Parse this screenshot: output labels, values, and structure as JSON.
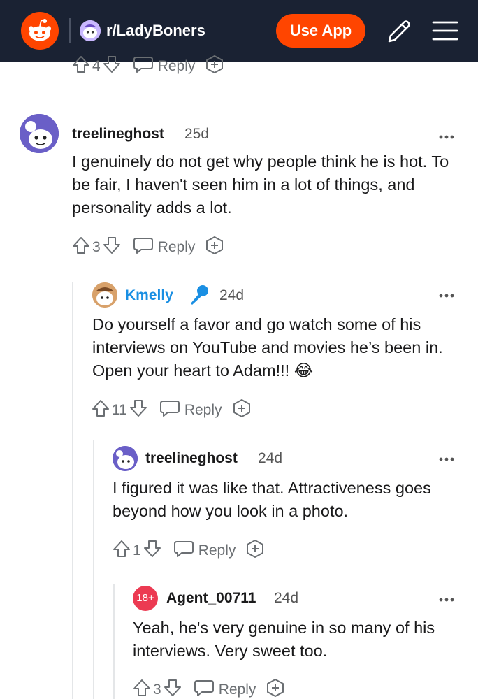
{
  "header": {
    "subreddit": "r/LadyBoners",
    "use_app_label": "Use App",
    "logo_icon": "reddit-logo-icon",
    "edit_icon": "pencil-icon",
    "menu_icon": "hamburger-menu-icon",
    "colors": {
      "bar": "#1a2233",
      "accent": "#ff4500"
    }
  },
  "previous_comment_actions": {
    "votes": "4",
    "reply_label": "Reply"
  },
  "comments": [
    {
      "username": "treelineghost",
      "age": "25d",
      "body": "I genuinely do not get why people think he is hot. To be fair, I haven't seen him in a lot of things, and personality adds a lot.",
      "votes": "3",
      "reply_label": "Reply"
    },
    {
      "username": "Kmelly",
      "flair_icon": "microphone-icon",
      "age": "24d",
      "body": "Do yourself a favor and go watch some of his interviews on YouTube and movies he’s been in. Open your heart to Adam!!! 😂",
      "votes": "11",
      "reply_label": "Reply"
    },
    {
      "username": "treelineghost",
      "age": "24d",
      "body": "I figured it was like that. Attractiveness goes beyond how you look in a photo.",
      "votes": "1",
      "reply_label": "Reply"
    },
    {
      "username": "Agent_00711",
      "avatar_badge": "18+",
      "age": "24d",
      "body": "Yeah, he's very genuine in so many of his interviews. Very sweet too.",
      "votes": "3",
      "reply_label": "Reply"
    }
  ]
}
